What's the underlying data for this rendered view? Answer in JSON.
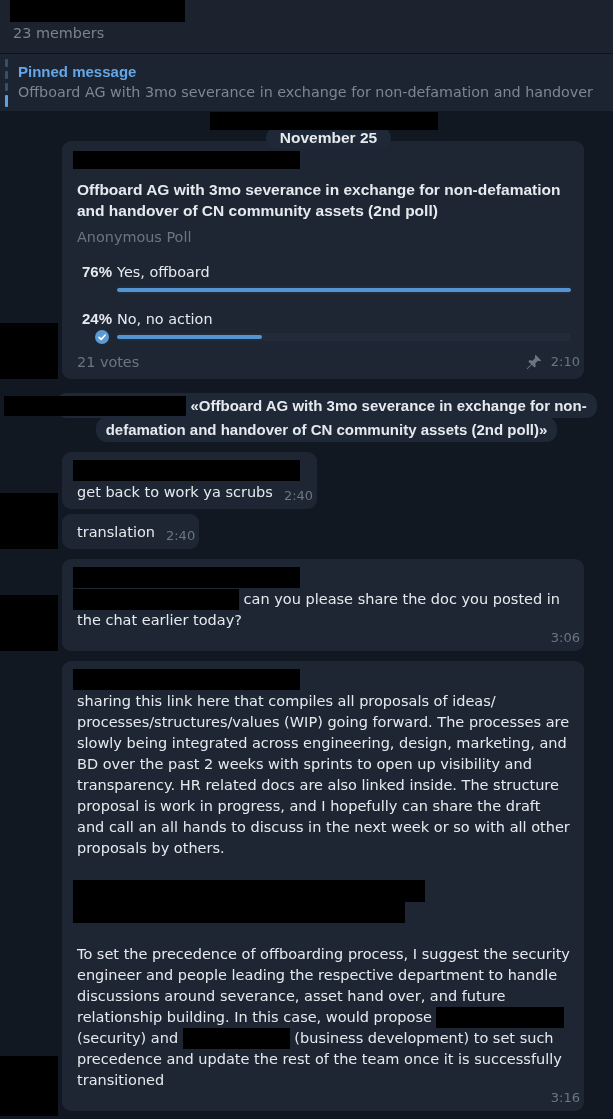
{
  "header": {
    "title_redacted": true,
    "subtitle": "23 members"
  },
  "pinned_bar": {
    "label": "Pinned message",
    "text": "Offboard AG with 3mo severance in exchange for non-defamation and handover"
  },
  "chat": {
    "top_redacted": true,
    "date": "November 25",
    "messages": [
      {
        "kind": "poll",
        "sender_redacted": true,
        "avatar_redacted": true,
        "question": "Offboard AG with 3mo severance in exchange for non-defamation and handover of CN community assets (2nd poll)",
        "poll_type": "Anonymous Poll",
        "options": [
          {
            "percent": "76%",
            "label": "Yes, offboard",
            "level": 1,
            "selected": false
          },
          {
            "percent": "24%",
            "label": "No, no action",
            "level": 0.32,
            "selected": true
          }
        ],
        "votes": "21 votes",
        "pinned": true,
        "time": "2:10"
      },
      {
        "kind": "service",
        "parts": [
          {
            "kind": "redaction"
          },
          {
            "kind": "text",
            "text": "«Offboard AG with 3mo severance in exchange for non-defamation and handover of CN community assets (2nd poll)»"
          }
        ]
      },
      {
        "kind": "text",
        "sender_redacted": true,
        "avatar_redacted": false,
        "blocks": [
          {
            "kind": "paragraph",
            "parts": [
              {
                "kind": "text",
                "text": "get back to work ya scrubs"
              }
            ]
          }
        ],
        "time": "2:40"
      },
      {
        "kind": "text",
        "sender_redacted": false,
        "avatar_redacted": true,
        "blocks": [
          {
            "kind": "paragraph",
            "parts": [
              {
                "kind": "text",
                "text": "translation"
              }
            ]
          }
        ],
        "time": "2:40"
      },
      {
        "kind": "text",
        "sender_redacted": true,
        "avatar_redacted": true,
        "blocks": [
          {
            "kind": "paragraph",
            "parts": [
              {
                "kind": "redaction"
              },
              {
                "kind": "text",
                "text": "can you please share the doc you posted in the chat earlier today?"
              }
            ]
          }
        ],
        "time": "3:06"
      },
      {
        "kind": "text",
        "sender_redacted": true,
        "avatar_redacted": true,
        "blocks": [
          {
            "kind": "paragraph",
            "parts": [
              {
                "kind": "text",
                "text": "sharing this link here that compiles all proposals of ideas/processes/structures/values (WIP) going forward. The processes are slowly being integrated across engineering, design, marketing, and BD over the past 2 weeks with sprints to open up visibility and transparency. HR related docs are also linked inside. The structure proposal is work in progress, and I hopefully can share the draft and call an all hands to discuss in the next week or so with all other proposals by others."
              }
            ]
          },
          {
            "kind": "redaction"
          },
          {
            "kind": "paragraph",
            "parts": [
              {
                "kind": "text",
                "text": "To set the precedence of offboarding process, I suggest the security engineer and people leading the respective department to handle discussions around severance, asset hand over, and future relationship building. In this case, would propose"
              },
              {
                "kind": "redaction"
              },
              {
                "kind": "text",
                "text": "(security) and"
              },
              {
                "kind": "redaction"
              },
              {
                "kind": "text",
                "text": "(business development) to set such precedence and update the rest of the team once it is successfully transitioned"
              }
            ]
          }
        ],
        "time": "3:16"
      }
    ]
  }
}
